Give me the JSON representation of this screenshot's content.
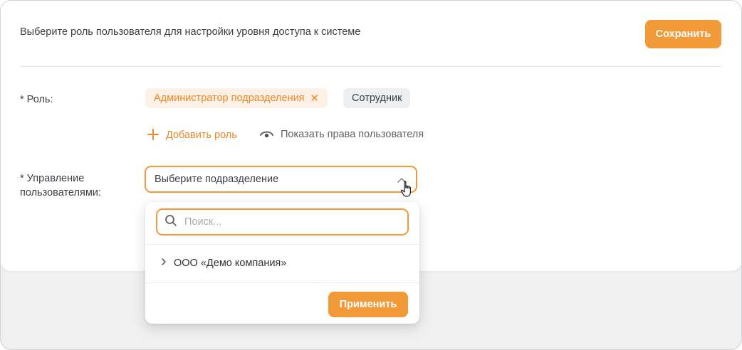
{
  "header": {
    "description": "Выберите роль пользователя для настройки уровня доступа к системе",
    "save_label": "Сохранить"
  },
  "form": {
    "role_label": "* Роль:",
    "roles_selected": [
      {
        "label": "Администратор подразделения",
        "state": "active"
      },
      {
        "label": "Сотрудник",
        "state": "inactive"
      }
    ],
    "add_role_label": "Добавить роль",
    "show_rights_label": "Показать права пользователя",
    "manage_label_line1": "* Управление",
    "manage_label_line2": "пользователями:",
    "select_placeholder": "Выберите подразделение"
  },
  "dropdown": {
    "search_placeholder": "Поиск...",
    "tree_items": [
      {
        "label": "ООО «Демо компания»",
        "expanded": false
      }
    ],
    "apply_label": "Применить"
  },
  "colors": {
    "accent": "#f39a38",
    "accent_text": "#e98a2c",
    "tag_active_bg": "#fdf0e4",
    "tag_inactive_bg": "#eeeff1"
  },
  "icons": {
    "tag_close": "close-icon",
    "add": "plus-icon",
    "show_rights": "eye-icon",
    "select": "chevron-up-icon",
    "search": "search-icon",
    "tree_expand": "chevron-right-icon",
    "cursor": "hand-pointer-icon"
  }
}
